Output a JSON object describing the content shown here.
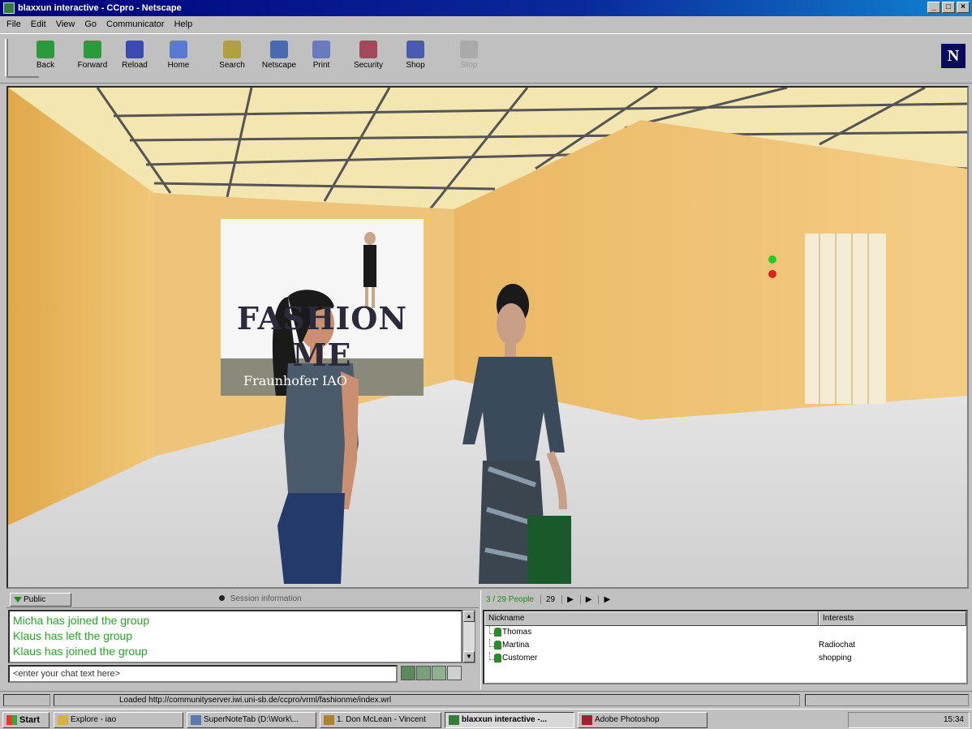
{
  "window": {
    "title": "blaxxun interactive - CCpro - Netscape"
  },
  "menu": [
    "File",
    "Edit",
    "View",
    "Go",
    "Communicator",
    "Help"
  ],
  "toolbar": {
    "buttons": [
      "Back",
      "Forward",
      "Reload",
      "Home",
      "Search",
      "Netscape",
      "Print",
      "Security",
      "Shop",
      "Stop"
    ]
  },
  "scene": {
    "poster_title": "FASHION ME",
    "poster_subtitle": "Fraunhofer IAO"
  },
  "chat": {
    "tab_label": "Public",
    "session_label": "Session information",
    "messages": [
      "Micha has joined the group",
      "Klaus has left the group",
      "Klaus has joined the group"
    ],
    "input_placeholder": "<enter your chat text here>"
  },
  "people": {
    "count_label": "3 / 29 People",
    "count2": "29",
    "columns": [
      "Nickname",
      "Interests"
    ],
    "rows": [
      {
        "name": "Thomas",
        "interest": ""
      },
      {
        "name": "Martina",
        "interest": "Radiochat"
      },
      {
        "name": "Customer",
        "interest": "shopping"
      }
    ]
  },
  "status": {
    "text": "Loaded http://communityserver.iwi.uni-sb.de/ccpro/vrml/fashionme/index.wrl"
  },
  "taskbar": {
    "start": "Start",
    "tasks": [
      "Explore - iao",
      "SuperNoteTab (D:\\Work\\...",
      "1. Don McLean - Vincent",
      "blaxxun interactive -...",
      "Adobe Photoshop"
    ],
    "clock": "15:34"
  }
}
